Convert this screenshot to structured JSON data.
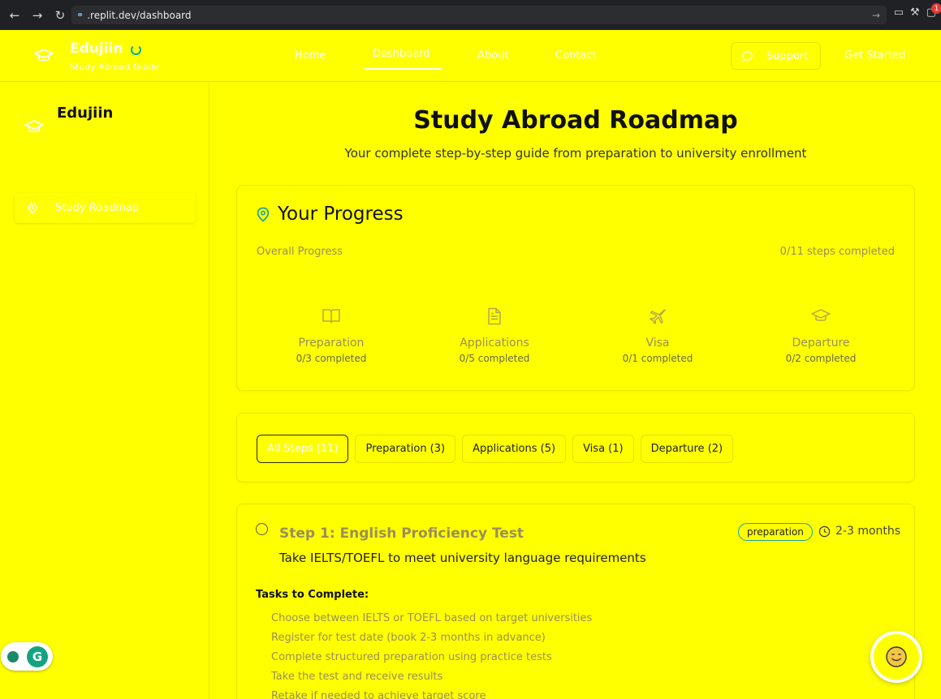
{
  "browser": {
    "url_domain": ".replit.dev",
    "url_path": "/dashboard",
    "notification_count": "1"
  },
  "header": {
    "brand": "Edujiin",
    "brand_subtitle": "Study Abroad Guide",
    "nav": [
      "Home",
      "Dashboard",
      "About",
      "Contact"
    ],
    "support_label": "Support",
    "get_started_label": "Get Started"
  },
  "sidebar": {
    "brand": "Edujiin",
    "items": [
      {
        "label": "Study Roadmap",
        "icon": "map-pin-icon"
      }
    ]
  },
  "main": {
    "title": "Study Abroad Roadmap",
    "subtitle": "Your complete step-by-step guide from preparation to university enrollment"
  },
  "progress": {
    "title": "Your Progress",
    "overall_label": "Overall Progress",
    "overall_count": "0/11 steps completed",
    "phases": [
      {
        "name": "Preparation",
        "count": "0/3 completed",
        "icon": "book-icon"
      },
      {
        "name": "Applications",
        "count": "0/5 completed",
        "icon": "document-icon"
      },
      {
        "name": "Visa",
        "count": "0/1 completed",
        "icon": "plane-icon"
      },
      {
        "name": "Departure",
        "count": "0/2 completed",
        "icon": "graduation-cap-icon"
      }
    ]
  },
  "filters": [
    {
      "label": "All Steps  (11)",
      "active": true
    },
    {
      "label": "Preparation  (3)",
      "active": false
    },
    {
      "label": "Applications  (5)",
      "active": false
    },
    {
      "label": "Visa  (1)",
      "active": false
    },
    {
      "label": "Departure  (2)",
      "active": false
    }
  ],
  "step": {
    "title": "Step 1: English Proficiency Test",
    "badge": "preparation",
    "duration": "2-3 months",
    "description": "Take IELTS/TOEFL to meet university language requirements",
    "tasks_heading": "Tasks to Complete:",
    "tasks": [
      "Choose between IELTS or TOEFL based on target universities",
      "Register for test date (book 2-3 months in advance)",
      "Complete structured preparation using practice tests",
      "Take the test and receive results",
      "Retake if needed to achieve target score"
    ]
  },
  "widgets": {
    "grammarly_letter": "G",
    "chat_icon": "smile-icon"
  }
}
